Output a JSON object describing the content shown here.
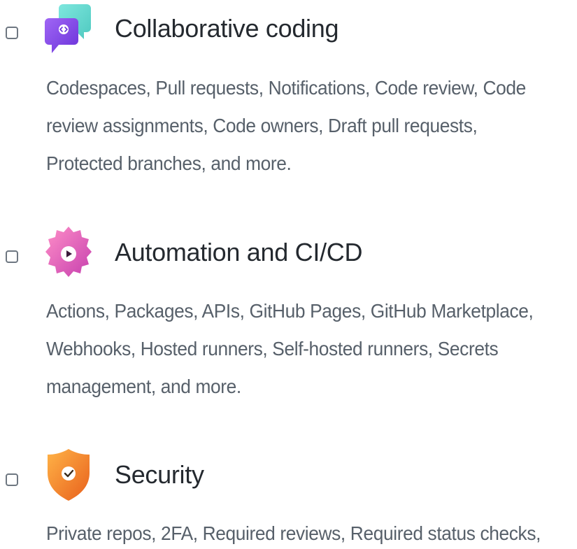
{
  "features": [
    {
      "title": "Collaborative coding",
      "icon": "code-chat-bubble-icon",
      "checked": false,
      "description_lines": [
        "Codespaces, Pull requests, Notifications, Code review, Code",
        "review assignments, Code owners, Draft pull requests,",
        "Protected branches, and more."
      ]
    },
    {
      "title": "Automation and CI/CD",
      "icon": "gear-play-icon",
      "checked": false,
      "description_lines": [
        "Actions, Packages, APIs, GitHub Pages, GitHub Marketplace,",
        "Webhooks, Hosted runners, Self-hosted runners, Secrets",
        "management, and more."
      ]
    },
    {
      "title": "Security",
      "icon": "shield-check-icon",
      "checked": false,
      "description_lines": [
        "Private repos, 2FA, Required reviews, Required status checks,"
      ]
    }
  ],
  "colors": {
    "title": "#24292f",
    "description": "#57606a",
    "checkbox_border": "#6e7781",
    "collab_purple": "#8a4cf0",
    "collab_teal": "#5fd9d0",
    "automation_pink": "#e45bb7",
    "security_orange": "#f0812a"
  }
}
